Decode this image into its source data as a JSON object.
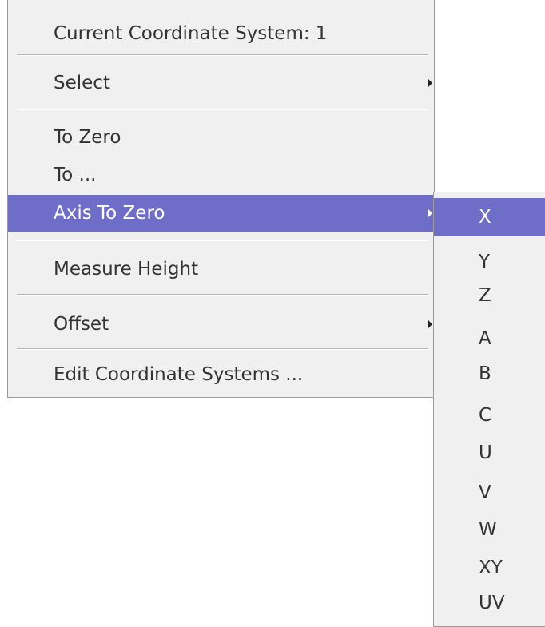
{
  "main_menu": {
    "items": [
      {
        "label": "Current Coordinate System: 1",
        "has_submenu": false,
        "selected": false
      },
      {
        "label": "Select",
        "has_submenu": true,
        "selected": false
      },
      {
        "label": "To Zero",
        "has_submenu": false,
        "selected": false
      },
      {
        "label": "To ...",
        "has_submenu": false,
        "selected": false
      },
      {
        "label": "Axis To Zero",
        "has_submenu": true,
        "selected": true
      },
      {
        "label": "Measure Height",
        "has_submenu": false,
        "selected": false
      },
      {
        "label": "Offset",
        "has_submenu": true,
        "selected": false
      },
      {
        "label": "Edit Coordinate Systems ...",
        "has_submenu": false,
        "selected": false
      }
    ]
  },
  "axis_submenu": {
    "items": [
      "X",
      "Y",
      "Z",
      "A",
      "B",
      "C",
      "U",
      "V",
      "W",
      "XY",
      "UV"
    ],
    "selected": "X"
  },
  "colors": {
    "menu_background": "#f0f0f0",
    "highlight": "#6e6ec8",
    "text": "#333333",
    "border": "#9a9a9a"
  }
}
